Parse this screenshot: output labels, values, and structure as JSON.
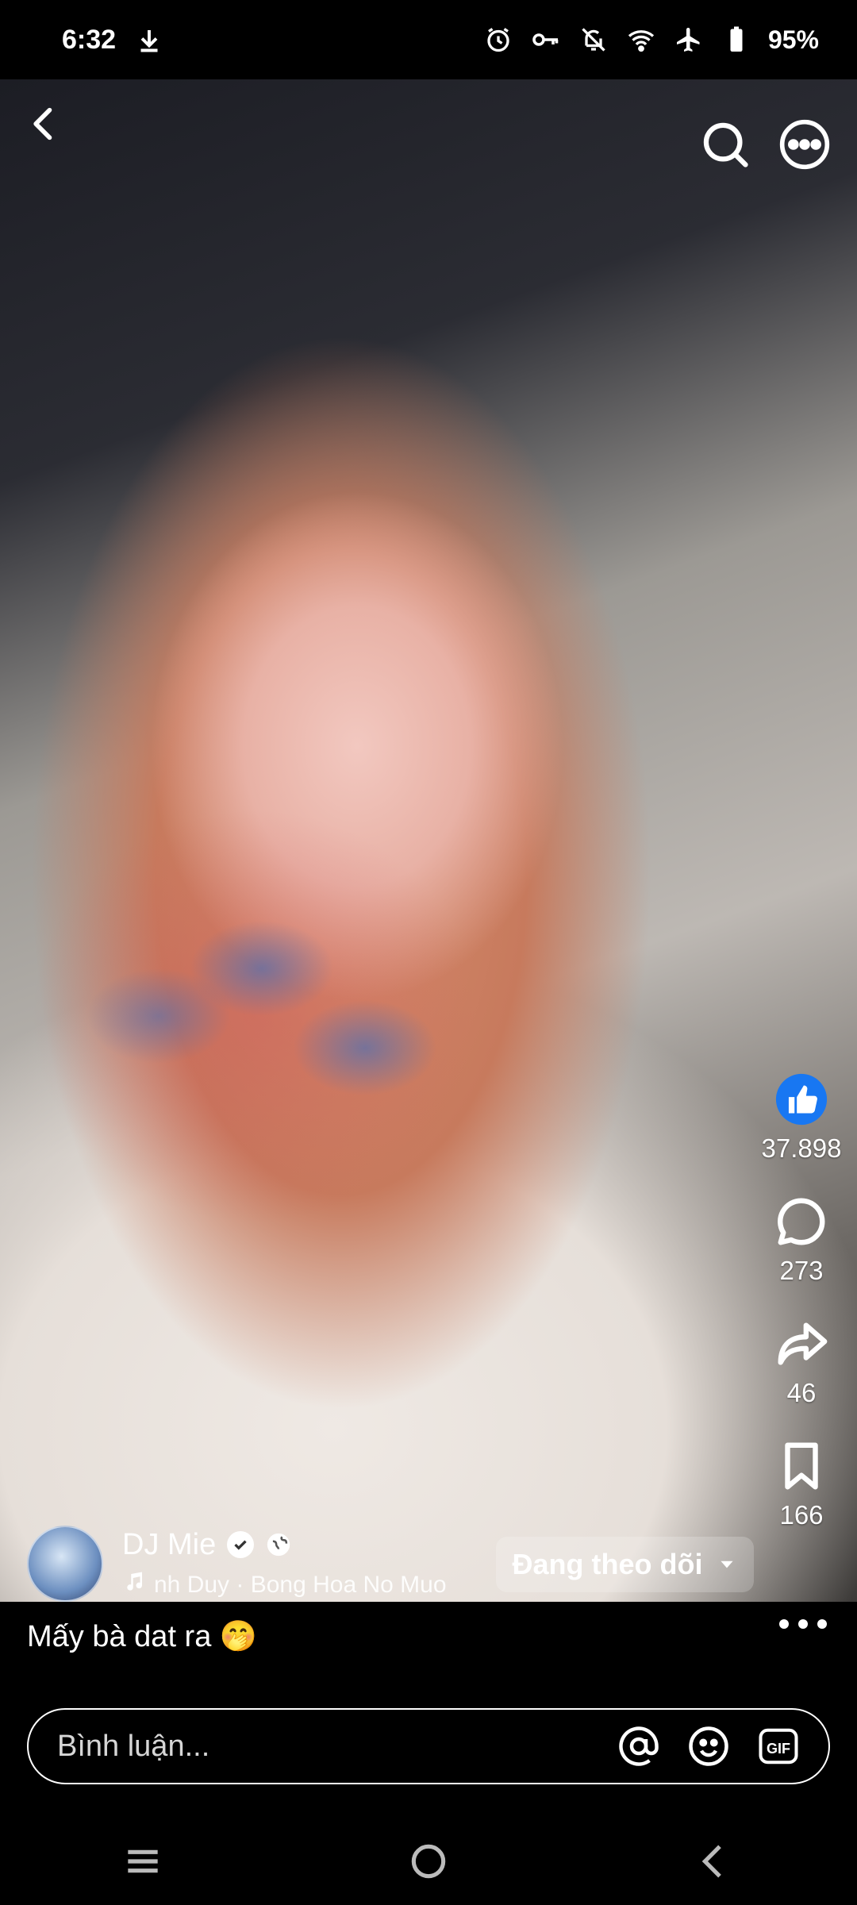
{
  "status_bar": {
    "time": "6:32",
    "battery": "95%",
    "icons": [
      "download-icon",
      "alarm-icon",
      "vpn-key-icon",
      "mute-icon",
      "wifi-icon",
      "airplane-icon",
      "battery-icon"
    ]
  },
  "video": {
    "top_icons": [
      "back-arrow-icon",
      "search-icon",
      "more-options-icon"
    ]
  },
  "actions": {
    "likes": "37.898",
    "comments": "273",
    "shares": "46",
    "saves": "166"
  },
  "author": {
    "name": "DJ Mie",
    "music": "nh Duy · Bong Hoa No Muo",
    "follow_label": "Đang theo dõi"
  },
  "caption": "Mấy bà dat ra 🤭",
  "comment": {
    "placeholder": "Bình luận..."
  },
  "colors": {
    "like_blue": "#1877f2"
  }
}
